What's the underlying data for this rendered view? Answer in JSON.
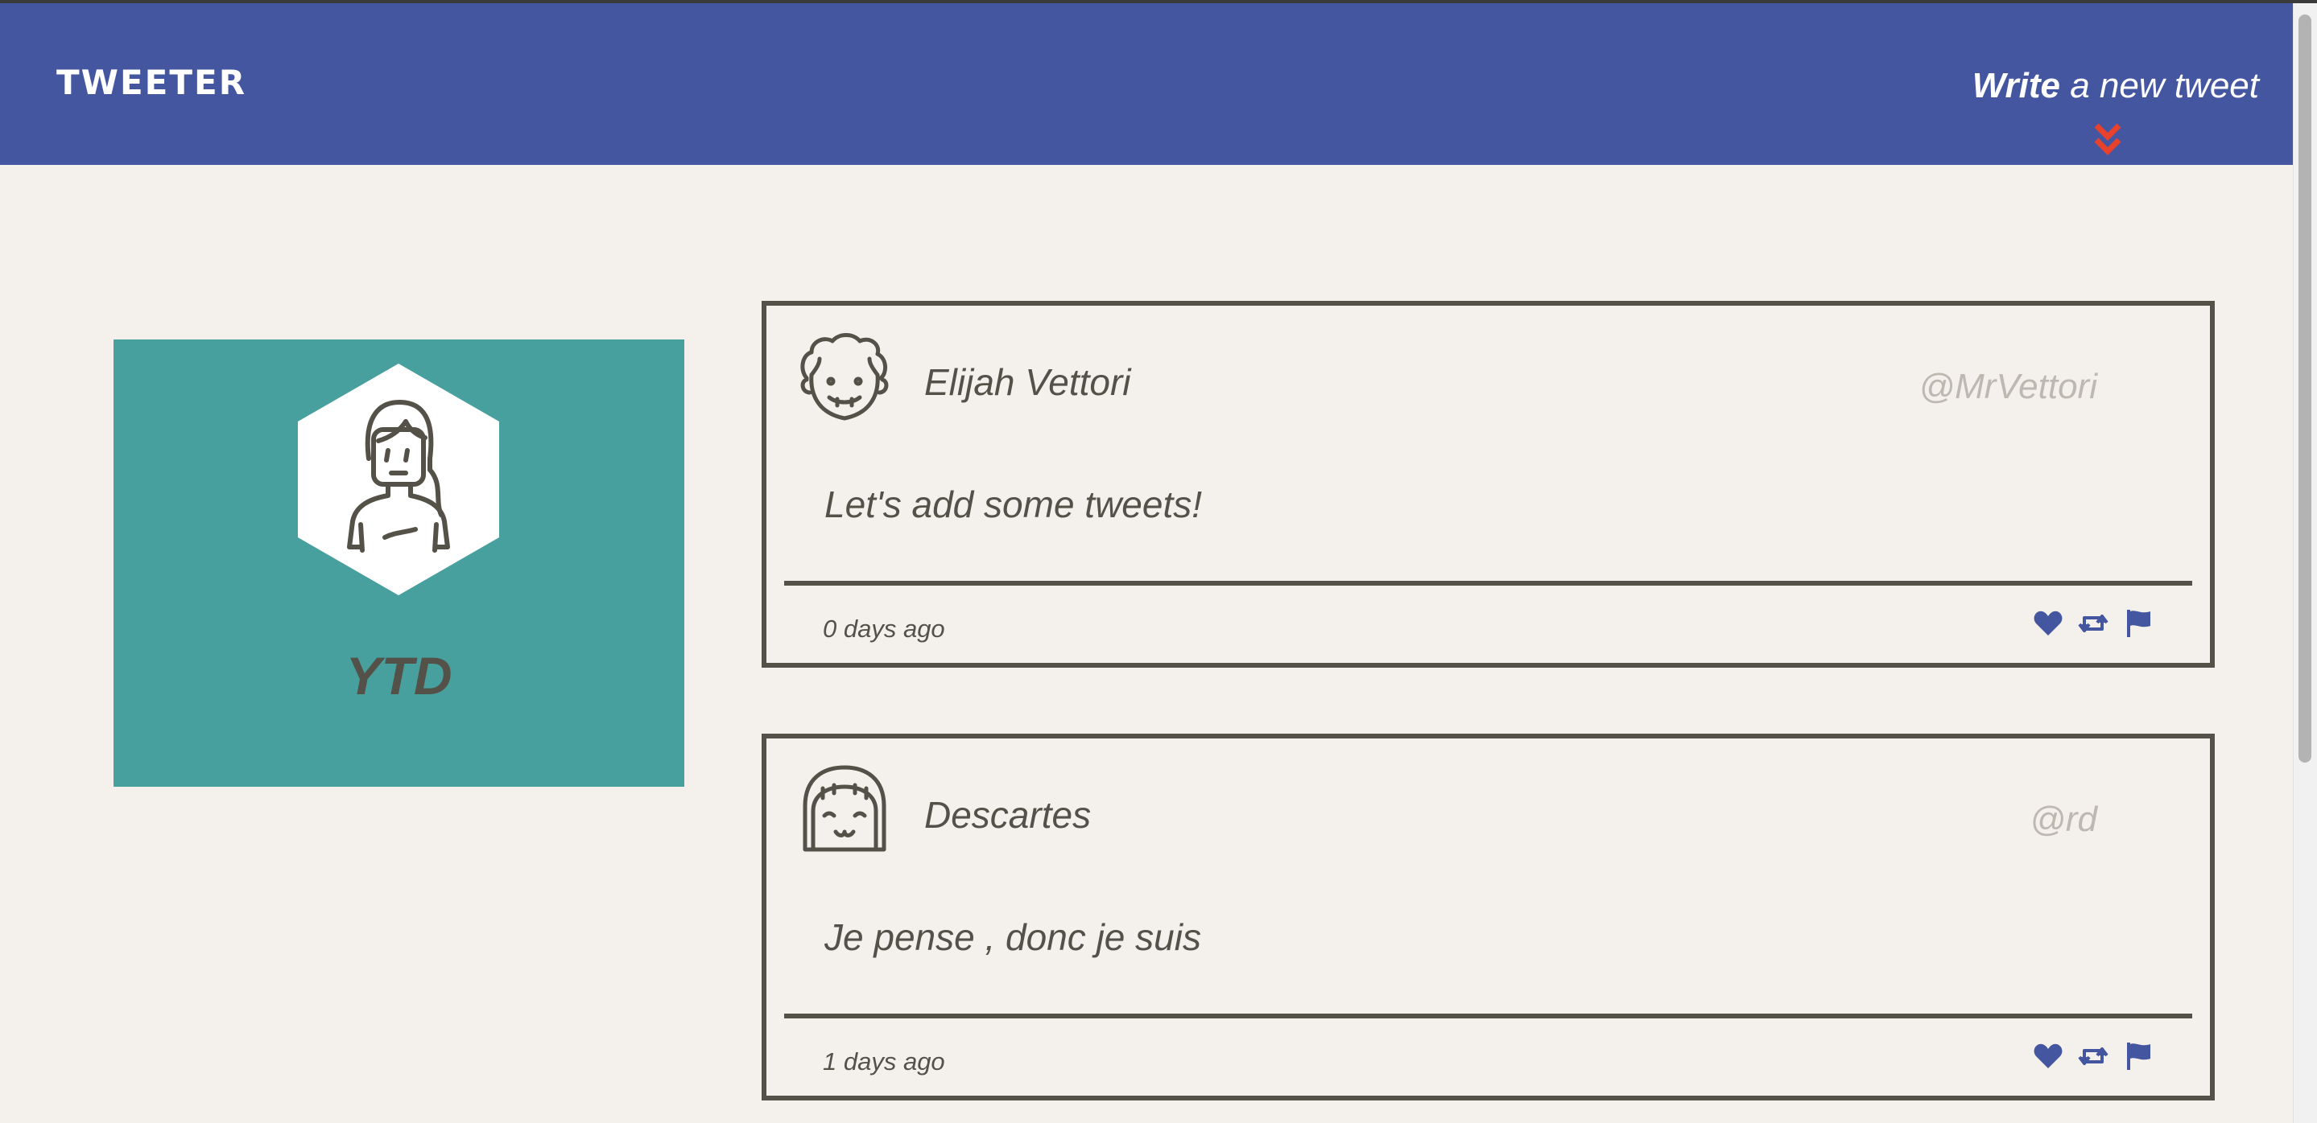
{
  "navbar": {
    "brand": "TWEETER",
    "compose_bold": "Write",
    "compose_rest": " a new tweet",
    "compose_icon": "double-chevron-down-icon",
    "accent_color": "#e8412c",
    "background_color": "#4556a0"
  },
  "profile": {
    "name": "YTD",
    "avatar_icon": "woman-avatar-icon",
    "background_color": "#47a09d"
  },
  "tweets": [
    {
      "name": "Elijah Vettori",
      "handle": "@MrVettori",
      "content": "Let's add some tweets!",
      "time": "0 days ago",
      "avatar_icon": "curly-hair-man-avatar-icon"
    },
    {
      "name": "Descartes",
      "handle": "@rd",
      "content": "Je pense , donc je suis",
      "time": "1 days ago",
      "avatar_icon": "bob-hair-girl-avatar-icon"
    }
  ],
  "action_icons": [
    "heart-icon",
    "retweet-icon",
    "flag-icon"
  ],
  "action_color": "#4556a0"
}
